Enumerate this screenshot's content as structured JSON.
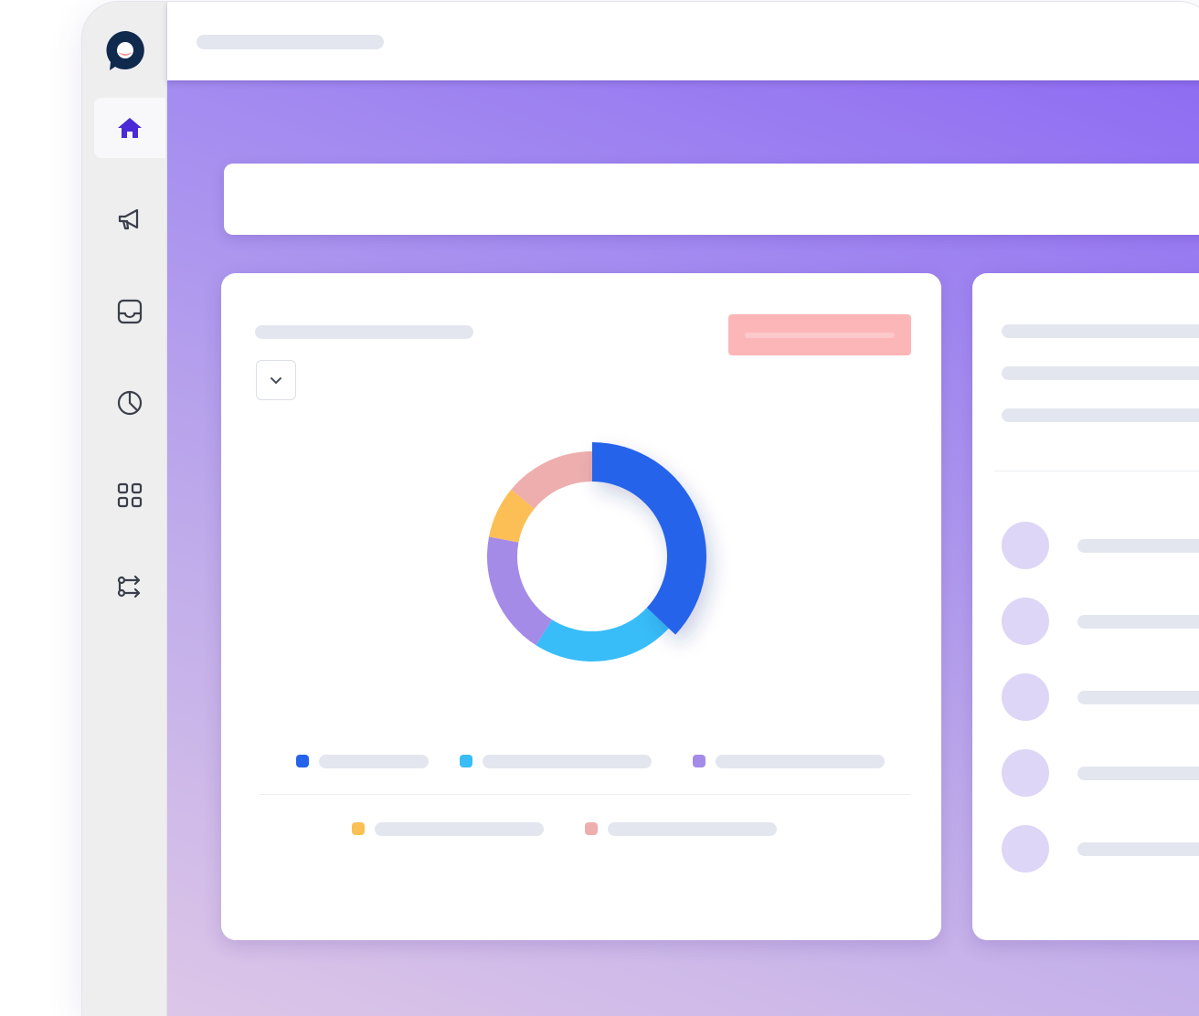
{
  "app": {
    "nav_items": [
      {
        "name": "home",
        "icon": "home-icon",
        "active": true
      },
      {
        "name": "campaigns",
        "icon": "megaphone-icon",
        "active": false
      },
      {
        "name": "inbox",
        "icon": "inbox-icon",
        "active": false
      },
      {
        "name": "reports",
        "icon": "pie-chart-icon",
        "active": false
      },
      {
        "name": "apps",
        "icon": "grid-icon",
        "active": false
      },
      {
        "name": "workflows",
        "icon": "workflow-icon",
        "active": false
      }
    ]
  },
  "colors": {
    "accent": "#4a2bd6",
    "logo": "#0f2a4d",
    "logo_dot": "#f29a96",
    "button_pink": "#fdb6b8",
    "skeleton": "#e3e6ee",
    "avatar": "#ddd6f6"
  },
  "chart_data": {
    "type": "pie",
    "variant": "donut",
    "legend_placement": "bottom",
    "series": [
      {
        "value": 37,
        "color": "#2563eb",
        "highlighted": true
      },
      {
        "value": 22,
        "color": "#38bdf8"
      },
      {
        "value": 19,
        "color": "#a48be8"
      },
      {
        "value": 8,
        "color": "#fbbf55"
      },
      {
        "value": 14,
        "color": "#eeaeae"
      }
    ]
  }
}
